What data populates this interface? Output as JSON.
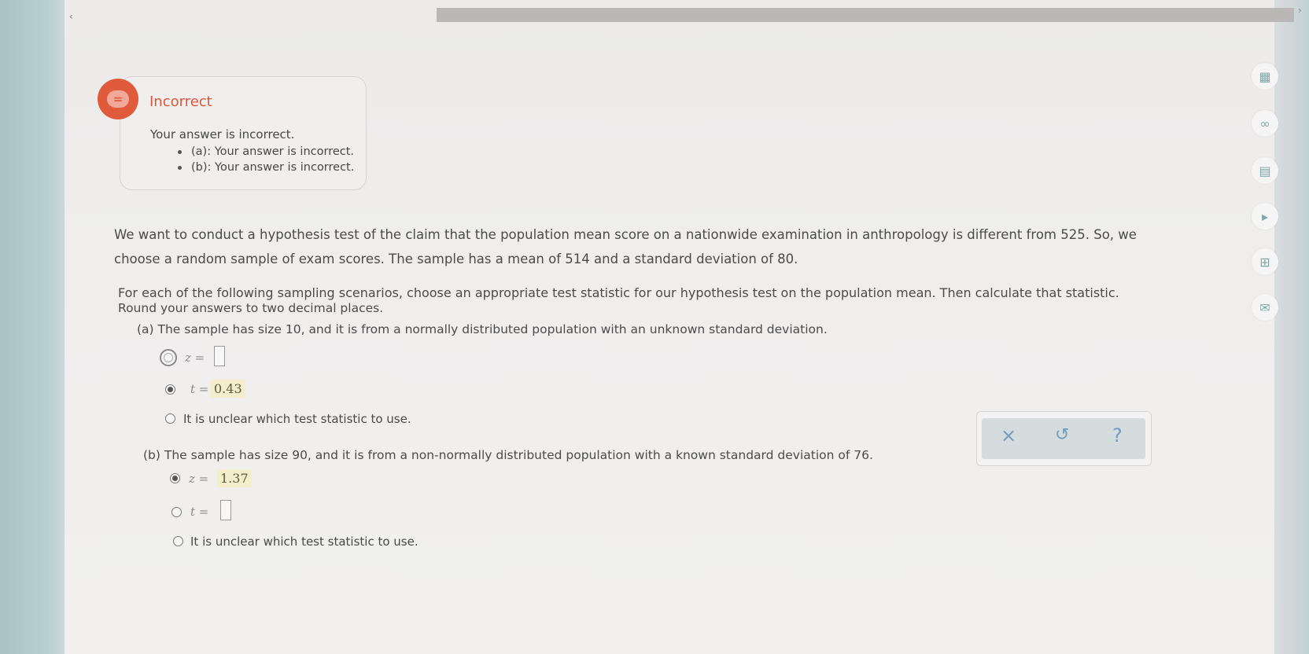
{
  "nav": {
    "back_glyph": "‹",
    "forward_glyph": "›"
  },
  "feedback": {
    "status": "Incorrect",
    "message": "Your answer is incorrect.",
    "items": [
      "(a): Your answer is incorrect.",
      "(b): Your answer is incorrect."
    ],
    "accent_color": "#e05a3c"
  },
  "question": {
    "intro_line1": "We want to conduct a hypothesis test of the claim that the population mean score on a nationwide examination in anthropology is different from 525. So, we",
    "intro_line2": "choose a random sample of exam scores. The sample has a mean of 514 and a standard deviation of 80.",
    "instr_line1": "For each of the following sampling scenarios, choose an appropriate test statistic for our hypothesis test on the population mean. Then calculate that statistic.",
    "instr_line2": "Round your answers to two decimal places."
  },
  "part_a": {
    "prompt": "(a) The sample has size 10, and it is from a normally distributed population with an unknown standard deviation.",
    "options": [
      {
        "label": "z =",
        "value": "",
        "selected": false
      },
      {
        "label": "t =",
        "value": "0.43",
        "selected": true
      },
      {
        "label": "It is unclear which test statistic to use.",
        "selected": false
      }
    ]
  },
  "part_b": {
    "prompt": "(b) The sample has size 90, and it is from a non-normally distributed population with a known standard deviation of 76.",
    "options": [
      {
        "label": "z =",
        "value": "1.37",
        "selected": true
      },
      {
        "label": "t =",
        "value": "",
        "selected": false
      },
      {
        "label": "It is unclear which test statistic to use.",
        "selected": false
      }
    ]
  },
  "actions": {
    "clear": "×",
    "undo": "↺",
    "help": "?"
  },
  "tools": [
    {
      "icon": "calculator-icon",
      "glyph": "▦"
    },
    {
      "icon": "infinity-icon",
      "glyph": "∞"
    },
    {
      "icon": "textbook-icon",
      "glyph": "▤"
    },
    {
      "icon": "video-icon",
      "glyph": "▸"
    },
    {
      "icon": "data-table-icon",
      "glyph": "⊞"
    },
    {
      "icon": "mail-icon",
      "glyph": "✉"
    }
  ]
}
